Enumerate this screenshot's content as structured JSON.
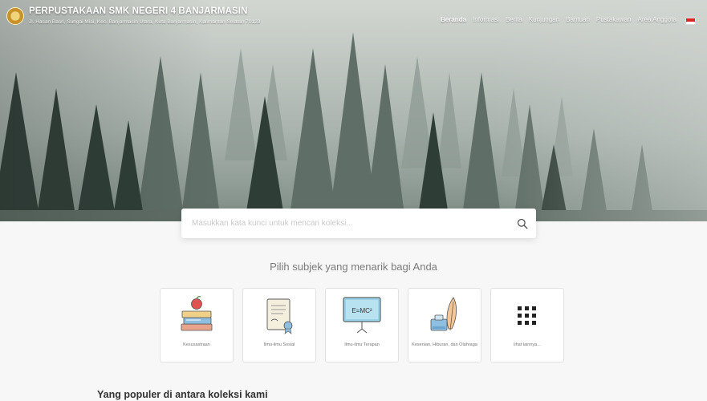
{
  "header": {
    "site_title": "PERPUSTAKAAN SMK NEGERI 4 BANJARMASIN",
    "address": "Jl. Hasan Basri, Sungai Miai, Kec. Banjarmasin Utara, Kota Banjarmasin, Kalimantan Selatan 70123",
    "logo_icon": "school-emblem-icon",
    "nav": [
      {
        "label": "Beranda",
        "active": true
      },
      {
        "label": "Informasi"
      },
      {
        "label": "Berita"
      },
      {
        "label": "Kunjungan"
      },
      {
        "label": "Bantuan"
      },
      {
        "label": "Pustakawan"
      },
      {
        "label": "Area Anggota"
      }
    ],
    "language_flag": "indonesia-flag-icon"
  },
  "search": {
    "placeholder": "Masukkan kata kunci untuk mencari koleksi...",
    "value": "",
    "button_icon": "search-icon"
  },
  "subjects": {
    "heading": "Pilih subjek yang menarik bagi Anda",
    "items": [
      {
        "label": "Kesusastraan",
        "icon": "books-apple-icon"
      },
      {
        "label": "Ilmu-ilmu Sosial",
        "icon": "certificate-scroll-icon"
      },
      {
        "label": "Ilmu-ilmu Terapan",
        "icon": "blackboard-formula-icon"
      },
      {
        "label": "Kesenian, Hiburan, dan Olahraga",
        "icon": "ink-feather-icon"
      },
      {
        "label": "lihat lainnya...",
        "icon": "grid-dots-icon"
      }
    ]
  },
  "popular": {
    "heading": "Yang populer di antara koleksi kami"
  },
  "colors": {
    "accent_red": "#e02424",
    "card_border": "#e2e2e2",
    "page_bg": "#f7f7f8"
  }
}
